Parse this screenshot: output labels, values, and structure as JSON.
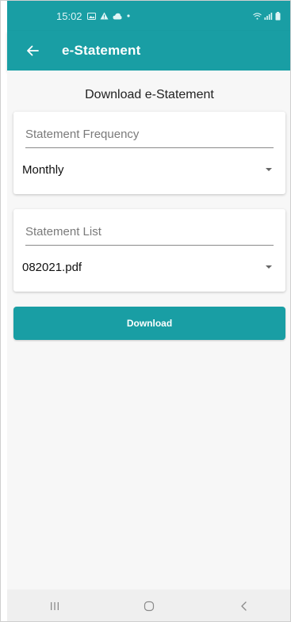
{
  "status_bar": {
    "time": "15:02",
    "notification_icons": [
      "image-icon",
      "alert-icon",
      "cloud-icon",
      "dot-icon"
    ],
    "right_icons": [
      "wifi-icon",
      "signal-icon",
      "battery-icon"
    ]
  },
  "app_bar": {
    "title": "e-Statement",
    "back_icon": "arrow-left-icon"
  },
  "main": {
    "heading": "Download e-Statement",
    "frequency": {
      "label": "Statement Frequency",
      "value": "Monthly"
    },
    "statement_list": {
      "label": "Statement List",
      "value": "082021.pdf"
    },
    "download_label": "Download"
  },
  "nav_bar": {
    "buttons": [
      "recents-icon",
      "home-icon",
      "back-icon"
    ]
  },
  "colors": {
    "primary": "#199ea4",
    "background": "#f7f7f7",
    "card": "#ffffff"
  }
}
